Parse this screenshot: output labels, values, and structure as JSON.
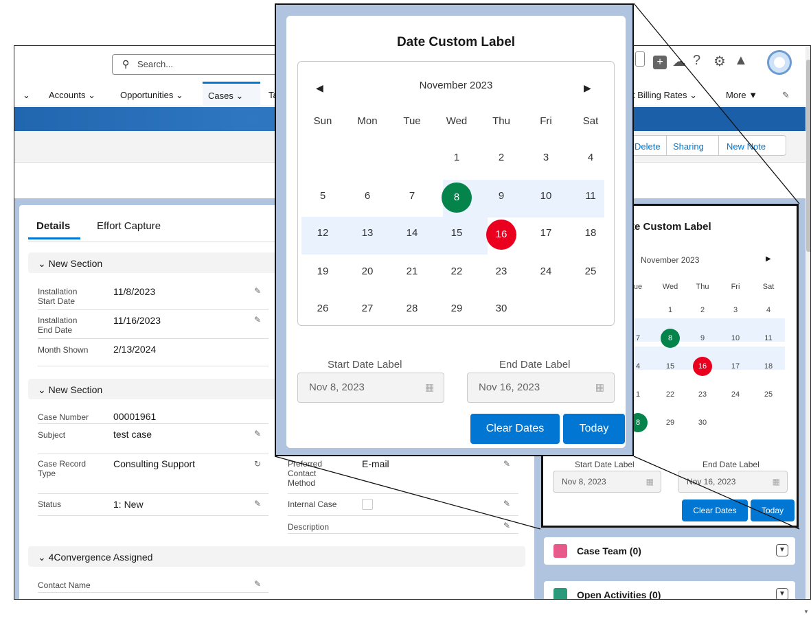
{
  "topbar": {
    "search_placeholder": "Search...",
    "help_glyph": "?"
  },
  "nav": {
    "items": [
      {
        "label": "Accounts"
      },
      {
        "label": "Opportunities"
      },
      {
        "label": "Cases"
      },
      {
        "label": "Ta"
      },
      {
        "label": "t Billing Rates"
      },
      {
        "label": "More"
      }
    ]
  },
  "actions": {
    "delete": "Delete",
    "sharing": "Sharing",
    "new_note": "New Note"
  },
  "tabs": {
    "details": "Details",
    "effort": "Effort Capture"
  },
  "section1": {
    "title": "New Section",
    "fields": [
      {
        "label": "Installation Start Date",
        "value": "11/8/2023"
      },
      {
        "label": "Installation End Date",
        "value": "11/16/2023"
      },
      {
        "label": "Month Shown",
        "value": "2/13/2024"
      }
    ]
  },
  "section2": {
    "title": "New Section",
    "fields": [
      {
        "label": "Case Number",
        "value": "00001961"
      },
      {
        "label": "Subject",
        "value": "test case"
      },
      {
        "label": "Case Record Type",
        "value": "Consulting Support"
      },
      {
        "label": "Status",
        "value": "1: New"
      }
    ],
    "right_fields": [
      {
        "label": "Preferred Contact Method",
        "value": "E-mail"
      },
      {
        "label": "Internal Case",
        "value": ""
      },
      {
        "label": "Description",
        "value": ""
      }
    ]
  },
  "section3": {
    "title": "4Convergence Assigned",
    "fields": [
      {
        "label": "Contact Name",
        "value": ""
      }
    ]
  },
  "small_calendar": {
    "title": "te Custom Label",
    "month": "November 2023",
    "dow": [
      "ue",
      "Wed",
      "Thu",
      "Fri",
      "Sat"
    ],
    "rows": [
      [
        "",
        "1",
        "2",
        "3",
        "4"
      ],
      [
        "7",
        "8",
        "9",
        "10",
        "11"
      ],
      [
        "4",
        "15",
        "16",
        "17",
        "18"
      ],
      [
        "1",
        "22",
        "23",
        "24",
        "25"
      ],
      [
        "8",
        "29",
        "30",
        "",
        ""
      ]
    ],
    "start_label": "Start Date Label",
    "end_label": "End Date Label",
    "start_value": "Nov 8, 2023",
    "end_value": "Nov 16, 2023",
    "clear": "Clear Dates",
    "today": "Today"
  },
  "cards": [
    {
      "title": "Case Team (0)",
      "color": "#e8598b"
    },
    {
      "title": "Open Activities (0)",
      "color": "#2a9a7a"
    }
  ],
  "popup": {
    "title": "Date Custom Label",
    "month": "November 2023",
    "dow": [
      "Sun",
      "Mon",
      "Tue",
      "Wed",
      "Thu",
      "Fri",
      "Sat"
    ],
    "weeks": [
      [
        "",
        "",
        "",
        "1",
        "2",
        "3",
        "4"
      ],
      [
        "5",
        "6",
        "7",
        "8",
        "9",
        "10",
        "11"
      ],
      [
        "12",
        "13",
        "14",
        "15",
        "16",
        "17",
        "18"
      ],
      [
        "19",
        "20",
        "21",
        "22",
        "23",
        "24",
        "25"
      ],
      [
        "26",
        "27",
        "28",
        "29",
        "30",
        "",
        ""
      ]
    ],
    "start_day": "8",
    "end_day": "16",
    "start_color": "#04844b",
    "end_color": "#ea001e",
    "range_color": "#e9f2fd",
    "start_label": "Start Date Label",
    "end_label": "End Date Label",
    "start_value": "Nov 8, 2023",
    "end_value": "Nov 16, 2023",
    "clear": "Clear Dates",
    "today": "Today"
  },
  "colors": {
    "accent": "#0176d3",
    "banner": "#1b5fa8",
    "page_bg": "#b0c4df"
  }
}
